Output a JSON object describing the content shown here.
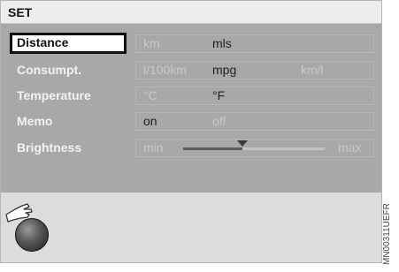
{
  "title": "SET",
  "rows": [
    {
      "label": "Distance",
      "selected": true,
      "options": [
        {
          "text": "km",
          "active": false
        },
        {
          "text": "mls",
          "active": true
        },
        {
          "text": "",
          "active": false
        }
      ]
    },
    {
      "label": "Consumpt.",
      "selected": false,
      "options": [
        {
          "text": "l/100km",
          "active": false
        },
        {
          "text": "mpg",
          "active": true
        },
        {
          "text": "km/l",
          "active": false
        }
      ]
    },
    {
      "label": "Temperature",
      "selected": false,
      "options": [
        {
          "text": "°C",
          "active": false
        },
        {
          "text": "°F",
          "active": true
        },
        {
          "text": "",
          "active": false
        }
      ]
    },
    {
      "label": "Memo",
      "selected": false,
      "options": [
        {
          "text": "on",
          "active": true
        },
        {
          "text": "off",
          "active": false
        },
        {
          "text": "",
          "active": false
        }
      ]
    }
  ],
  "brightness": {
    "label": "Brightness",
    "min_label": "min",
    "max_label": "max",
    "level": 0.42
  },
  "controller_icon": "idrive-controller-icon",
  "image_code": "MN00311UEFR"
}
